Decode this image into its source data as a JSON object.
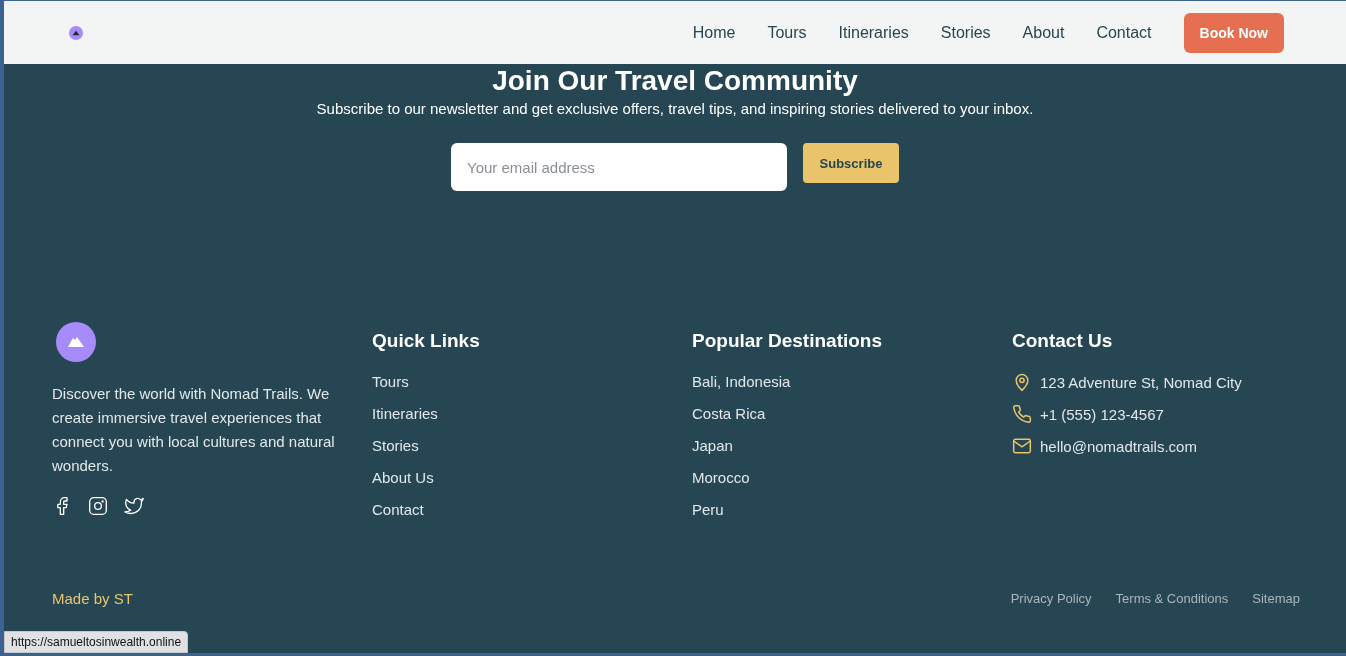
{
  "header": {
    "nav": [
      {
        "label": "Home"
      },
      {
        "label": "Tours"
      },
      {
        "label": "Itineraries"
      },
      {
        "label": "Stories"
      },
      {
        "label": "About"
      },
      {
        "label": "Contact"
      }
    ],
    "cta": "Book Now"
  },
  "newsletter": {
    "title": "Join Our Travel Community",
    "text": "Subscribe to our newsletter and get exclusive offers, travel tips, and inspiring stories delivered to your inbox.",
    "email": {
      "placeholder": "Your email address"
    },
    "button": "Subscribe"
  },
  "footer": {
    "about": "Discover the world with Nomad Trails. We create immersive travel experiences that connect you with local cultures and natural wonders.",
    "socials": [
      {
        "kind": "facebook"
      },
      {
        "kind": "instagram"
      },
      {
        "kind": "twitter"
      }
    ],
    "columns": [
      {
        "title": "Quick Links",
        "links": [
          "Tours",
          "Itineraries",
          "Stories",
          "About Us",
          "Contact"
        ]
      },
      {
        "title": "Popular Destinations",
        "links": [
          "Bali, Indonesia",
          "Costa Rica",
          "Japan",
          "Morocco",
          "Peru"
        ]
      }
    ],
    "contact": {
      "title": "Contact Us",
      "items": [
        {
          "kind": "address",
          "text": "123 Adventure St, Nomad City"
        },
        {
          "kind": "phone",
          "text": "+1 (555) 123-4567"
        },
        {
          "kind": "email",
          "text": "hello@nomadtrails.com"
        }
      ]
    },
    "credit": "Made by ST",
    "legal": [
      "Privacy Policy",
      "Terms & Conditions",
      "Sitemap"
    ]
  },
  "status_bar": {
    "url": "https://samueltosinwealth.online"
  }
}
